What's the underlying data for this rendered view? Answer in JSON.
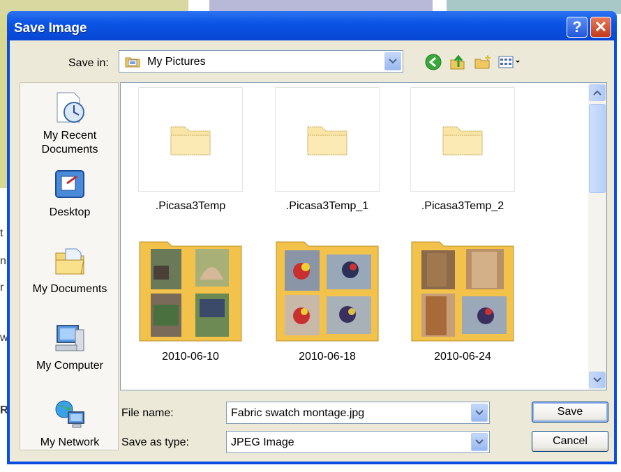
{
  "window": {
    "title": "Save Image",
    "help_glyph": "?",
    "close_glyph": "✕"
  },
  "toolbar": {
    "save_in_label": "Save in:",
    "save_in_value": "My Pictures"
  },
  "places": [
    {
      "label_line1": "My Recent",
      "label_line2": "Documents",
      "icon": "recent-documents-icon"
    },
    {
      "label_line1": "Desktop",
      "label_line2": "",
      "icon": "desktop-icon"
    },
    {
      "label_line1": "My Documents",
      "label_line2": "",
      "icon": "my-documents-icon"
    },
    {
      "label_line1": "My Computer",
      "label_line2": "",
      "icon": "my-computer-icon"
    },
    {
      "label_line1": "My Network",
      "label_line2": "",
      "icon": "my-network-icon"
    }
  ],
  "files": [
    {
      "name": ".Picasa3Temp",
      "kind": "folder"
    },
    {
      "name": ".Picasa3Temp_1",
      "kind": "folder"
    },
    {
      "name": ".Picasa3Temp_2",
      "kind": "folder"
    },
    {
      "name": "2010-06-10",
      "kind": "photo-folder"
    },
    {
      "name": "2010-06-18",
      "kind": "photo-folder"
    },
    {
      "name": "2010-06-24",
      "kind": "photo-folder"
    }
  ],
  "form": {
    "file_name_label": "File name:",
    "file_name_value": "Fabric swatch montage.jpg",
    "type_label": "Save as type:",
    "type_value": "JPEG Image",
    "save_label": "Save",
    "cancel_label": "Cancel"
  },
  "background_fragments": [
    "t",
    "n",
    "r",
    "w",
    "R"
  ],
  "colors": {
    "titlebar": "#0b55e4",
    "dialog_face": "#ece9d8",
    "field_border": "#7f9db9"
  }
}
